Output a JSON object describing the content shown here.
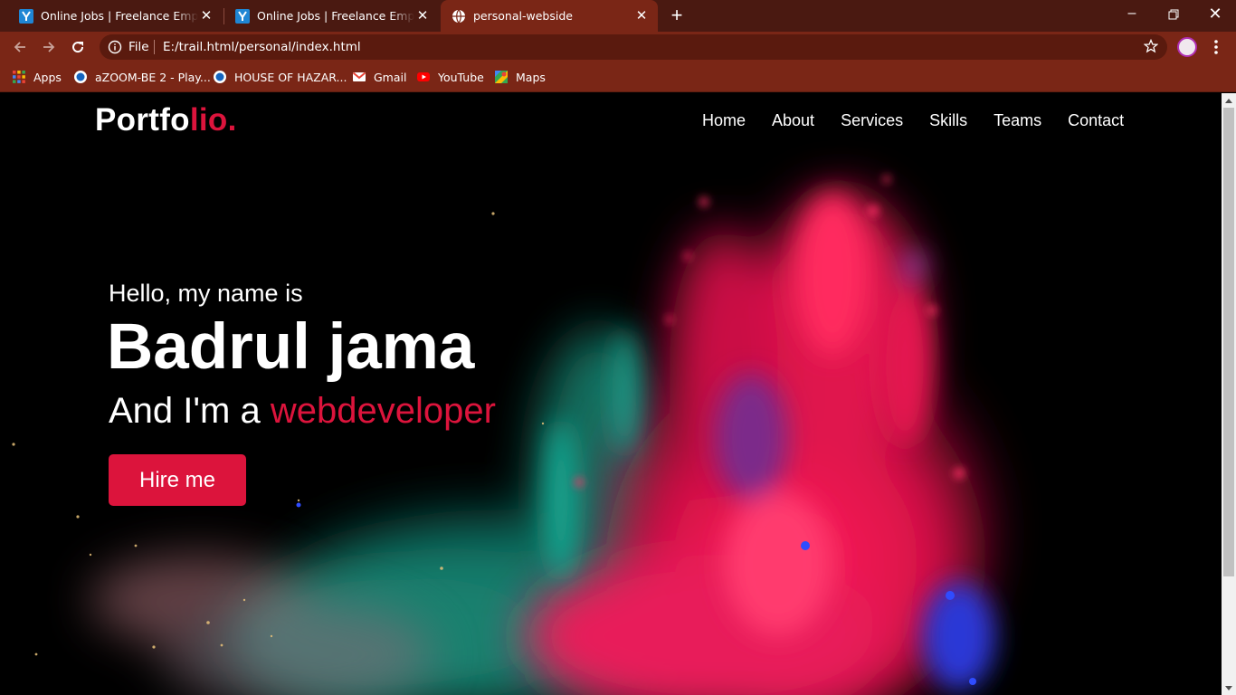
{
  "browser": {
    "tabs": [
      {
        "title": "Online Jobs | Freelance Employment",
        "favicon": "upwork-y-icon",
        "active": false
      },
      {
        "title": "Online Jobs | Freelance Employment",
        "favicon": "upwork-y-icon",
        "active": false
      },
      {
        "title": "personal-webside",
        "favicon": "globe-icon",
        "active": true
      }
    ],
    "address": {
      "scheme_label": "File",
      "url": "E:/trail.html/personal/index.html"
    },
    "bookmarks": [
      {
        "label": "Apps",
        "icon": "apps-grid-icon"
      },
      {
        "label": "aZOOM-BE 2 - Play...",
        "icon": "blue-circle-icon"
      },
      {
        "label": "HOUSE OF HAZAR...",
        "icon": "blue-circle-icon"
      },
      {
        "label": "Gmail",
        "icon": "gmail-icon"
      },
      {
        "label": "YouTube",
        "icon": "youtube-icon"
      },
      {
        "label": "Maps",
        "icon": "maps-icon"
      }
    ],
    "colors": {
      "frame": "#4a1911",
      "toolbar": "#7a2616",
      "omnibox": "#5a1a0e"
    }
  },
  "site": {
    "logo_main": "Portfo",
    "logo_accent": "lio.",
    "nav": [
      "Home",
      "About",
      "Services",
      "Skills",
      "Teams",
      "Contact"
    ],
    "hero": {
      "greeting": "Hello, my name is",
      "name": "Badrul jama",
      "role_prefix": "And I'm a ",
      "role_accent": "webdeveloper",
      "cta": "Hire me"
    },
    "colors": {
      "accent": "#dc143c",
      "background": "#000000",
      "text": "#ffffff"
    }
  }
}
